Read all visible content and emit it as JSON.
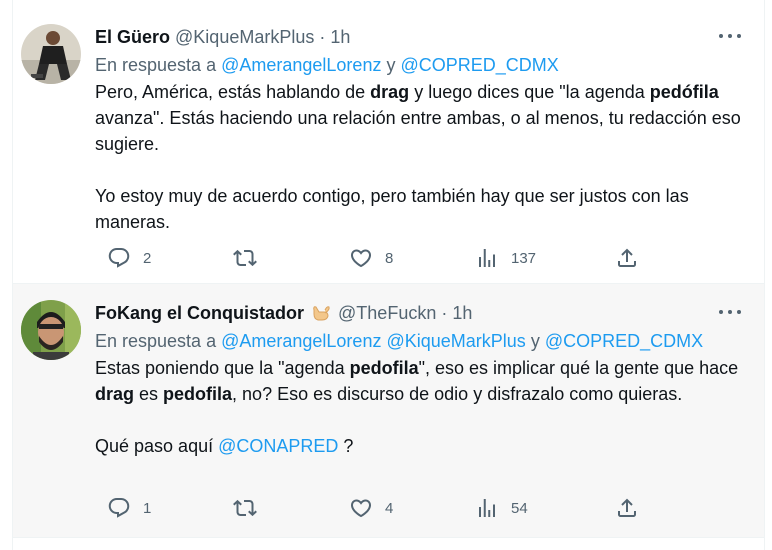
{
  "tweets": [
    {
      "author_name": "El Güero",
      "author_handle": "@KiqueMarkPlus",
      "separator": "·",
      "time": "1h",
      "reply_prefix": "En respuesta a",
      "reply_mentions": [
        "@AmerangelLorenz",
        "@COPRED_CDMX"
      ],
      "reply_joiner": "y",
      "body": {
        "p1": [
          "Pero, América, estás hablando de ",
          "drag",
          " y luego dices que \"la agenda ",
          "pedófila",
          " avanza\". Estás haciendo una relación entre ambas, o al menos, tu redacción eso sugiere."
        ],
        "p2": "Yo estoy muy de acuerdo contigo, pero también hay que ser justos con las maneras."
      },
      "actions": {
        "replies": "2",
        "retweets": "",
        "likes": "8",
        "views": "137"
      }
    },
    {
      "author_name": "FoKang el Conquistador",
      "author_emoji": "call-me-hand-emoji",
      "author_handle": "@TheFuckn",
      "separator": "·",
      "time": "1h",
      "reply_prefix": "En respuesta a",
      "reply_mentions": [
        "@AmerangelLorenz",
        "@KiqueMarkPlus",
        "@COPRED_CDMX"
      ],
      "reply_joiner": "y",
      "body": {
        "p1": [
          "Estas poniendo que la \"agenda ",
          "pedofila",
          "\", eso es implicar qué la gente que hace ",
          "drag",
          " es ",
          "pedofila",
          ", no? Eso es discurso de odio y disfrazalo como quieras."
        ],
        "p2_text": "Qué paso aquí ",
        "p2_mention": "@CONAPRED",
        "p2_end": " ?"
      },
      "actions": {
        "replies": "1",
        "retweets": "",
        "likes": "4",
        "views": "54"
      }
    }
  ],
  "colors": {
    "link": "#1d9bf0",
    "muted": "#536471",
    "text": "#0f1419",
    "hover_bg": "#f7f7f7"
  }
}
